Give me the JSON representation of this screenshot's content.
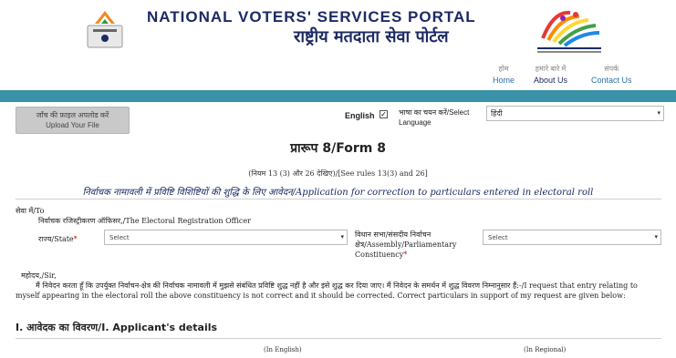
{
  "header": {
    "title_en": "NATIONAL VOTERS' SERVICES PORTAL",
    "title_hi": "राष्ट्रीय मतदाता सेवा पोर्टल",
    "nav": [
      {
        "hi": "होम",
        "en": "Home"
      },
      {
        "hi": "हमारे बारे में",
        "en": "About Us"
      },
      {
        "hi": "संपर्क",
        "en": "Contact Us"
      }
    ],
    "brand_color": "#1c2a63",
    "bar_color": "#3a93a9"
  },
  "toolbar": {
    "upload_hi": "जाँच की फ़ाइल अपलोड करें",
    "upload_en": "Upload Your File",
    "english_label": "English",
    "english_checked": "✓",
    "language_label": "भाषा का चयन करें/Select Language",
    "language_value": "हिंदी"
  },
  "form": {
    "title": "प्रारूप 8/Form 8",
    "rules": "(नियम 13 (3) और 26 देखिए)/[See rules 13(3) and 26]",
    "app_title": "निर्वाचक नामावली में प्रविष्टि विशिष्टियों की शुद्धि के लिए आवेदन/Application for correction to particulars entered in electoral roll",
    "to_label": "सेवा में/To",
    "ero": "निर्वाचक रजिस्ट्रीकरण ऑफिसर,/The Electoral Registration Officer",
    "state_label": "राज्य/State",
    "state_value": "Select",
    "ac_label": "विधान सभा/संसदीय निर्वाचन क्षेत्र/Assembly/Parliamentary Constituency",
    "ac_value": "Select",
    "required_mark": "*",
    "sir": "महोदय,/Sir,",
    "paragraph": "मैं निवेदन करता हूँ कि उपर्युक्त निर्वाचन-क्षेत्र की निर्वाचक नामावली में मुझसे संबंधित प्रविष्टि शुद्ध नहीं है और इसे शुद्ध कर दिया जाए। मैं निवेदन के समर्थन में शुद्ध विवरण निम्नानुसार हैं:-/I request that entry relating to myself appearing in the electoral roll the above constituency is not correct and it should be corrected. Correct particulars in support of my request are given below:",
    "section_title": "I. आवेदक का विवरण/I. Applicant's details",
    "col_en": "(In English)",
    "col_regional": "(In Regional)"
  }
}
